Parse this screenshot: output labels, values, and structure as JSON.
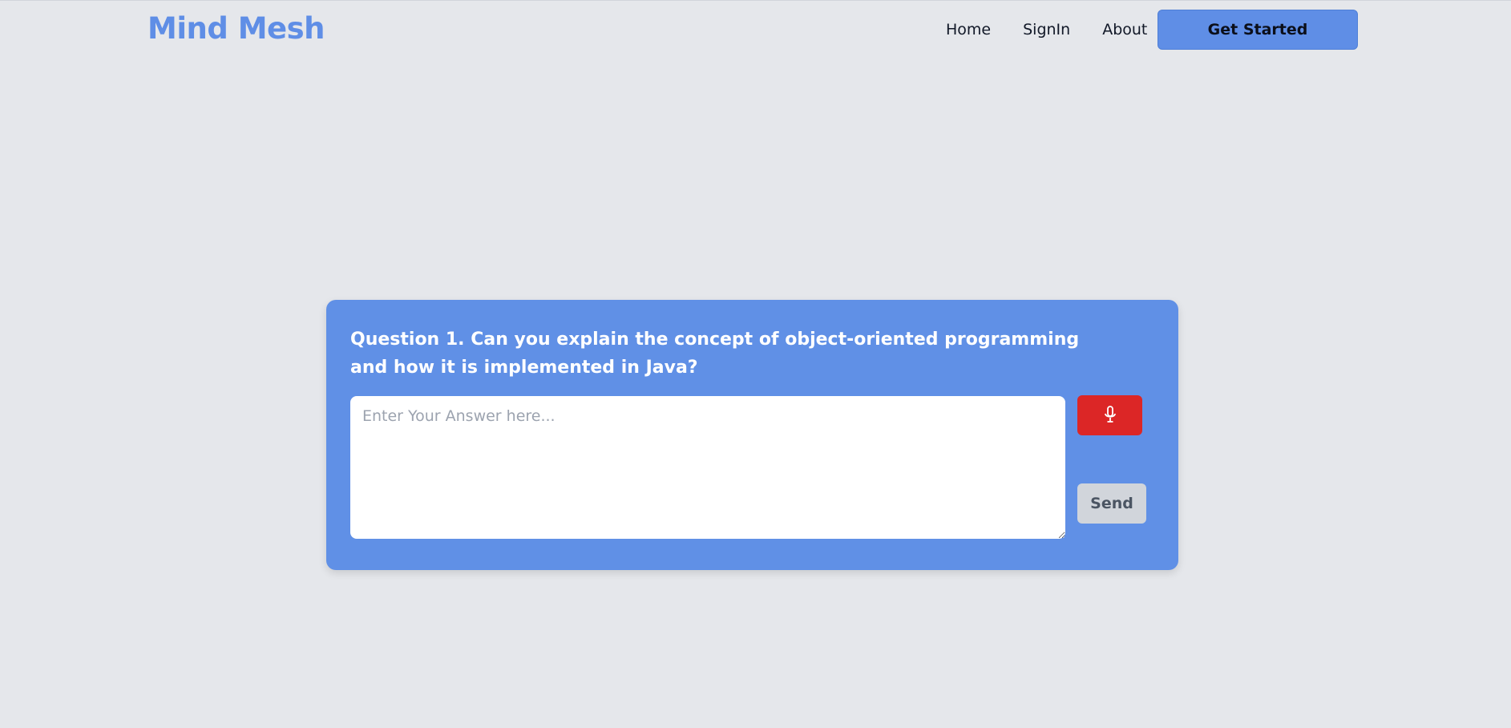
{
  "app": {
    "brand": "Mind Mesh"
  },
  "nav": {
    "links": [
      "Home",
      "SignIn",
      "About"
    ],
    "cta_label": "Get Started"
  },
  "colors": {
    "brand": "#5f8ee6",
    "card": "#6090e6",
    "mic": "#dc2626",
    "send": "#d1d5db",
    "background": "#e5e7eb"
  },
  "question_card": {
    "question": "Question 1. Can you explain the concept of object-oriented programming and how it is implemented in Java?",
    "answer_value": "",
    "answer_placeholder": "Enter Your Answer here...",
    "mic_icon": "microphone-icon",
    "send_label": "Send"
  }
}
